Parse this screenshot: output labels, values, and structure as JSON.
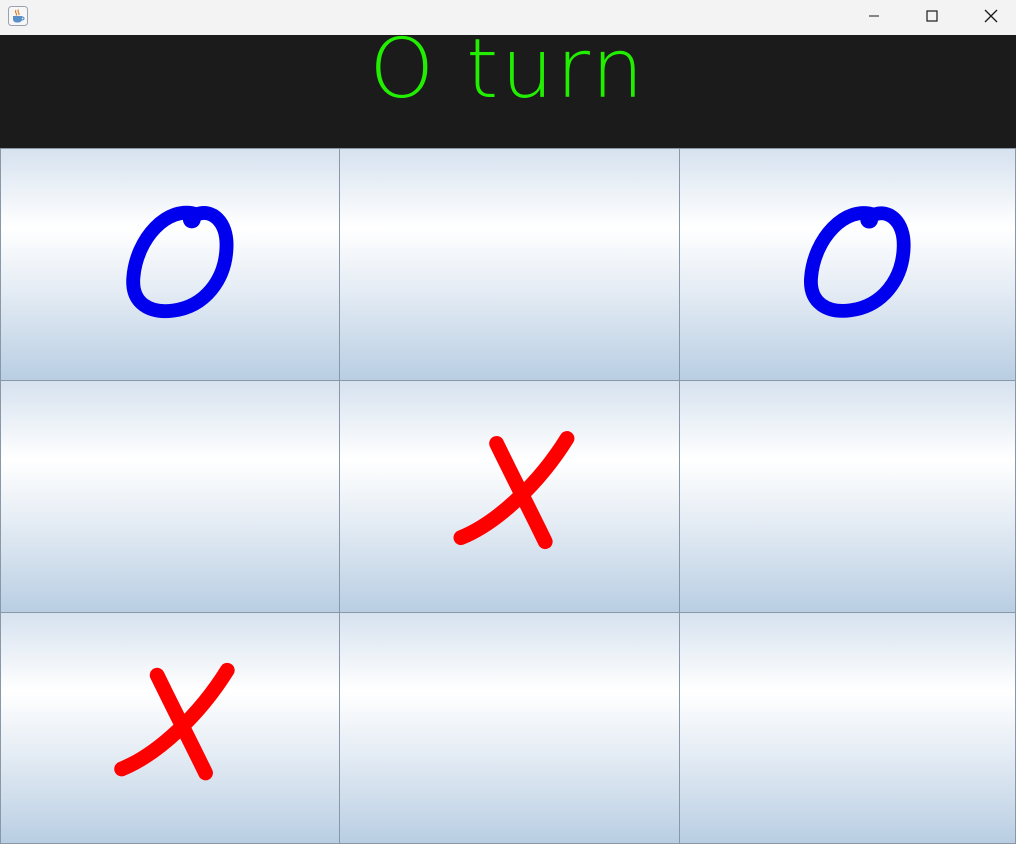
{
  "window": {
    "icon": "java-cup-icon",
    "controls": [
      "minimize-icon",
      "maximize-icon",
      "close-icon"
    ]
  },
  "header": {
    "turn_text": "O turn",
    "text_color": "#22ef00",
    "background": "#1b1b1b"
  },
  "board": {
    "cells": [
      {
        "row": 0,
        "col": 0,
        "mark": "O"
      },
      {
        "row": 0,
        "col": 1,
        "mark": ""
      },
      {
        "row": 0,
        "col": 2,
        "mark": "O"
      },
      {
        "row": 1,
        "col": 0,
        "mark": ""
      },
      {
        "row": 1,
        "col": 1,
        "mark": "X"
      },
      {
        "row": 1,
        "col": 2,
        "mark": ""
      },
      {
        "row": 2,
        "col": 0,
        "mark": "X"
      },
      {
        "row": 2,
        "col": 1,
        "mark": ""
      },
      {
        "row": 2,
        "col": 2,
        "mark": ""
      }
    ],
    "o_color": "#0000ee",
    "x_color": "#ff0000"
  }
}
